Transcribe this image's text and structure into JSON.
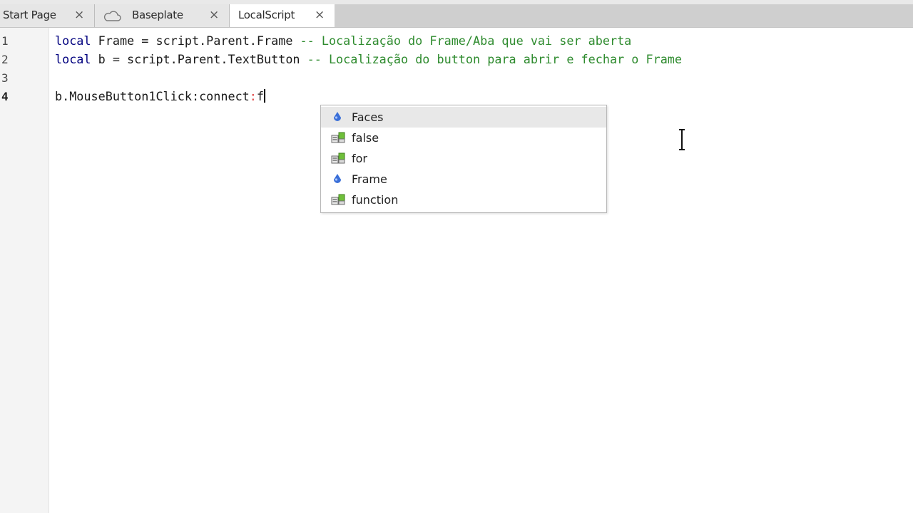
{
  "tabs": [
    {
      "label": "Start Page",
      "close": "×"
    },
    {
      "label": "Baseplate",
      "close": "×",
      "icon": "cloud-icon"
    },
    {
      "label": "LocalScript",
      "close": "×",
      "active": true
    }
  ],
  "editor": {
    "line_numbers": [
      "1",
      "2",
      "3",
      "4"
    ],
    "current_line": "4",
    "lines": {
      "l1_kw": "local",
      "l1_code": " Frame = script.Parent.Frame ",
      "l1_comment": "-- Localização do Frame/Aba que vai ser aberta",
      "l2_kw": "local",
      "l2_code": " b = script.Parent.TextButton ",
      "l2_comment": "-- Localização do button para abrir e fechar o Frame",
      "l4_code": "b.MouseButton1Click:connect",
      "l4_err": ":",
      "l4_typed": "f"
    }
  },
  "autocomplete": {
    "items": [
      {
        "label": "Faces",
        "icon": "property-icon",
        "selected": true
      },
      {
        "label": "false",
        "icon": "keyword-icon"
      },
      {
        "label": "for",
        "icon": "keyword-icon"
      },
      {
        "label": "Frame",
        "icon": "property-icon"
      },
      {
        "label": "function",
        "icon": "keyword-icon"
      }
    ]
  },
  "colors": {
    "keyword": "#00007f",
    "comment": "#2e8b2e",
    "tabbar": "#cfcfcf"
  }
}
